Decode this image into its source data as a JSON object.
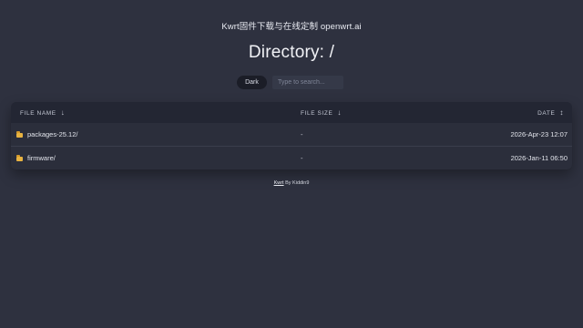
{
  "header": {
    "site_title": "Kwrt固件下载与在线定制 openwrt.ai",
    "directory_title": "Directory: /"
  },
  "controls": {
    "theme_button_label": "Dark",
    "search_placeholder": "Type to search...",
    "search_value": ""
  },
  "table": {
    "columns": [
      {
        "label": "FILE NAME",
        "sort_icon": "↓"
      },
      {
        "label": "FILE SIZE",
        "sort_icon": "↓"
      },
      {
        "label": "DATE",
        "sort_icon": "↕"
      }
    ],
    "rows": [
      {
        "icon": "folder-icon",
        "name": "packages-25.12/",
        "size": "-",
        "date": "2026-Apr-23 12:07"
      },
      {
        "icon": "folder-icon",
        "name": "firmware/",
        "size": "-",
        "date": "2026-Jan-11 06:50"
      }
    ]
  },
  "footer": {
    "link_label": "Kwrt",
    "suffix": " By Kiddin9"
  },
  "colors": {
    "background": "#2e313f",
    "table_header": "#232633",
    "folder": "#e8b341"
  }
}
